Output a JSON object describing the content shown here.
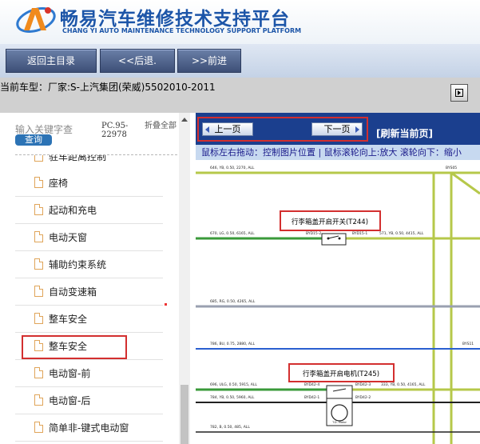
{
  "header": {
    "title": "畅易汽车维修技术支持平台",
    "subtitle": "CHANG YI AUTO MAINTENANCE TECHNOLOGY SUPPORT PLATFORM"
  },
  "toolbar": {
    "home_label": "返回主目录",
    "back_label": "<<后退.",
    "forward_label": ">>前进"
  },
  "vehicle": {
    "label": "当前车型：",
    "value": "厂家:S-上汽集团(荣威)5502010-2011"
  },
  "sidebar": {
    "search_placeholder": "输入关键字查",
    "search_button": "查询",
    "pc_tag_line1": "PC.95-",
    "pc_tag_line2": "22978",
    "fold_all": "折叠全部",
    "cut_item": "驻车距离控制",
    "items": [
      {
        "label": "座椅"
      },
      {
        "label": "起动和充电"
      },
      {
        "label": "电动天窗"
      },
      {
        "label": "辅助约束系统"
      },
      {
        "label": "自动变速箱"
      },
      {
        "label": "整车安全"
      },
      {
        "label": "整车安全"
      },
      {
        "label": "电动窗-前"
      },
      {
        "label": "电动窗-后"
      },
      {
        "label": "简单非-键式电动窗"
      }
    ],
    "selected_index": 6
  },
  "viewer": {
    "prev_label": "上一页",
    "next_label": "下一页",
    "refresh_label": "[刷新当前页]",
    "hint": "鼠标左右拖动：控制图片位置 | 鼠标滚轮向上:放大  滚轮向下：缩小"
  },
  "diagram": {
    "label_t244": "行李箱盖开启开关(T244)",
    "label_t245": "行李箱盖开启电机(T245)",
    "wires": [
      {
        "text": "646, YB, 0.50, 2270, ALL"
      },
      {
        "text": "670, LG, 0.50, 6165, ALL"
      },
      {
        "text": "685, RG, 0.50, 4265, ALL"
      },
      {
        "text": "786, BU, 0.75, 2880, ALL"
      },
      {
        "text": "696, ULG, 0.50, 5915, ALL"
      },
      {
        "text": "784, YB, 0.50, 5960, ALL"
      },
      {
        "text": "782, B, 0.50, 485, ALL"
      }
    ],
    "connectors": {
      "byd15_2": "BYD15-2",
      "byd15_1": "BYD15-1",
      "wire_571": "571, YB, 0.50, 4415, ALL",
      "bys05": "BYS05",
      "bys11": "BYS11",
      "byd42_4": "BYD42-4",
      "byd42_3": "BYD42-3",
      "wire_333": "333, YB, 0.50, 4165, ALL",
      "byd42_1": "BYD42-1",
      "byd42_2": "BYD42-2",
      "motor": "T.D. Motor"
    },
    "colors": {
      "yellow_green": "#b6c84a",
      "green": "#3a9a3a",
      "gray": "#9aa0b0",
      "blue": "#2a5fd0",
      "black": "#222222"
    }
  }
}
